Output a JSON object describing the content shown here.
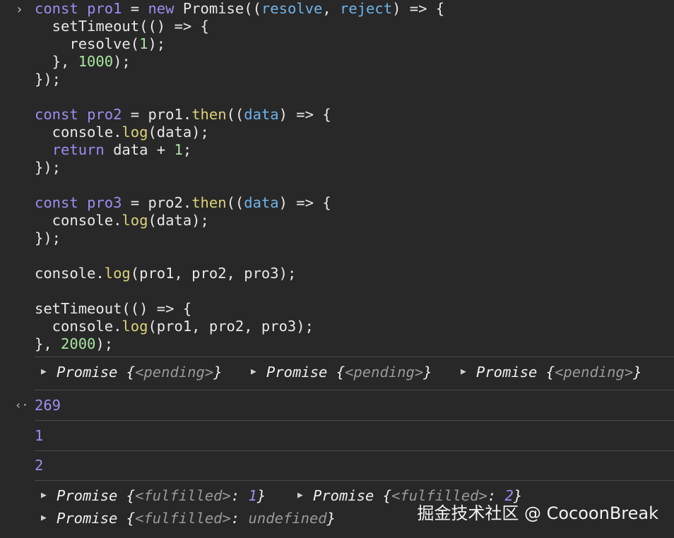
{
  "prompt_symbol": "›",
  "code_lines": [
    [
      {
        "t": "const",
        "c": "kw"
      },
      {
        "t": " "
      },
      {
        "t": "pro1",
        "c": "id"
      },
      {
        "t": " = "
      },
      {
        "t": "new",
        "c": "kw"
      },
      {
        "t": " Promise(("
      },
      {
        "t": "resolve",
        "c": "pm"
      },
      {
        "t": ", "
      },
      {
        "t": "reject",
        "c": "pm"
      },
      {
        "t": ") => {"
      }
    ],
    [
      {
        "t": "  setTimeout(() => {"
      }
    ],
    [
      {
        "t": "    resolve("
      },
      {
        "t": "1",
        "c": "num"
      },
      {
        "t": ");"
      }
    ],
    [
      {
        "t": "  }, "
      },
      {
        "t": "1000",
        "c": "num"
      },
      {
        "t": ");"
      }
    ],
    [
      {
        "t": "});"
      }
    ],
    [
      {
        "t": ""
      }
    ],
    [
      {
        "t": "const",
        "c": "kw"
      },
      {
        "t": " "
      },
      {
        "t": "pro2",
        "c": "id"
      },
      {
        "t": " = pro1."
      },
      {
        "t": "then",
        "c": "fn"
      },
      {
        "t": "(("
      },
      {
        "t": "data",
        "c": "pm"
      },
      {
        "t": ") => {"
      }
    ],
    [
      {
        "t": "  console."
      },
      {
        "t": "log",
        "c": "fn"
      },
      {
        "t": "(data);"
      }
    ],
    [
      {
        "t": "  "
      },
      {
        "t": "return",
        "c": "kw"
      },
      {
        "t": " data + "
      },
      {
        "t": "1",
        "c": "num"
      },
      {
        "t": ";"
      }
    ],
    [
      {
        "t": "});"
      }
    ],
    [
      {
        "t": ""
      }
    ],
    [
      {
        "t": "const",
        "c": "kw"
      },
      {
        "t": " "
      },
      {
        "t": "pro3",
        "c": "id"
      },
      {
        "t": " = pro2."
      },
      {
        "t": "then",
        "c": "fn"
      },
      {
        "t": "(("
      },
      {
        "t": "data",
        "c": "pm"
      },
      {
        "t": ") => {"
      }
    ],
    [
      {
        "t": "  console."
      },
      {
        "t": "log",
        "c": "fn"
      },
      {
        "t": "(data);"
      }
    ],
    [
      {
        "t": "});"
      }
    ],
    [
      {
        "t": ""
      }
    ],
    [
      {
        "t": "console."
      },
      {
        "t": "log",
        "c": "fn"
      },
      {
        "t": "(pro1, pro2, pro3);"
      }
    ],
    [
      {
        "t": ""
      }
    ],
    [
      {
        "t": "setTimeout(() => {"
      }
    ],
    [
      {
        "t": "  console."
      },
      {
        "t": "log",
        "c": "fn"
      },
      {
        "t": "(pro1, pro2, pro3);"
      }
    ],
    [
      {
        "t": "}, "
      },
      {
        "t": "2000",
        "c": "num"
      },
      {
        "t": ");"
      }
    ]
  ],
  "log1": {
    "p1": {
      "cls": "Promise",
      "state": "<pending>"
    },
    "p2": {
      "cls": "Promise",
      "state": "<pending>"
    },
    "p3": {
      "cls": "Promise",
      "state": "<pending>"
    }
  },
  "return_arrow": "‹·",
  "return_value": "269",
  "log2_value": "1",
  "log3_value": "2",
  "log4": {
    "p1": {
      "cls": "Promise",
      "state": "<fulfilled>",
      "value": "1"
    },
    "p2": {
      "cls": "Promise",
      "state": "<fulfilled>",
      "value": "2"
    },
    "p3": {
      "cls": "Promise",
      "state": "<fulfilled>",
      "value": "undefined"
    }
  },
  "expand_icon": "▶",
  "watermark": "掘金技术社区 @ CocoonBreak"
}
